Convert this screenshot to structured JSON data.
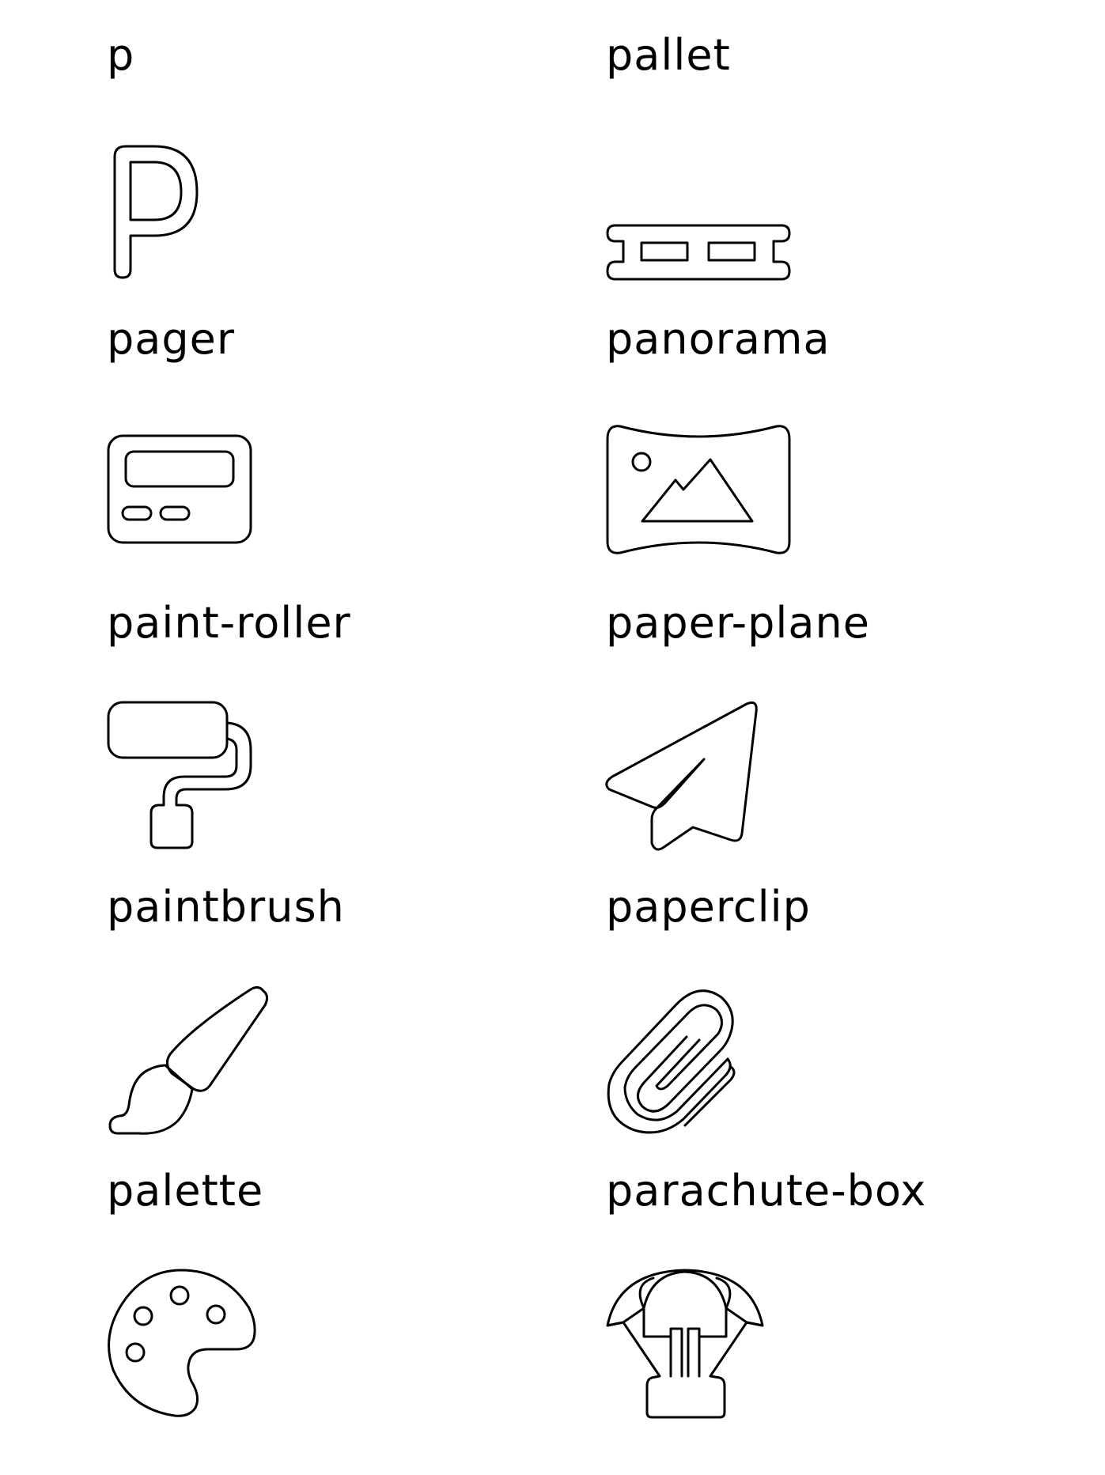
{
  "icons": [
    {
      "label": "p",
      "icon": "p-letter-icon"
    },
    {
      "label": "pallet",
      "icon": "pallet-icon"
    },
    {
      "label": "pager",
      "icon": "pager-icon"
    },
    {
      "label": "panorama",
      "icon": "panorama-icon"
    },
    {
      "label": "paint-roller",
      "icon": "paint-roller-icon"
    },
    {
      "label": "paper-plane",
      "icon": "paper-plane-icon"
    },
    {
      "label": "paintbrush",
      "icon": "paintbrush-icon"
    },
    {
      "label": "paperclip",
      "icon": "paperclip-icon"
    },
    {
      "label": "palette",
      "icon": "palette-icon"
    },
    {
      "label": "parachute-box",
      "icon": "parachute-box-icon"
    }
  ]
}
